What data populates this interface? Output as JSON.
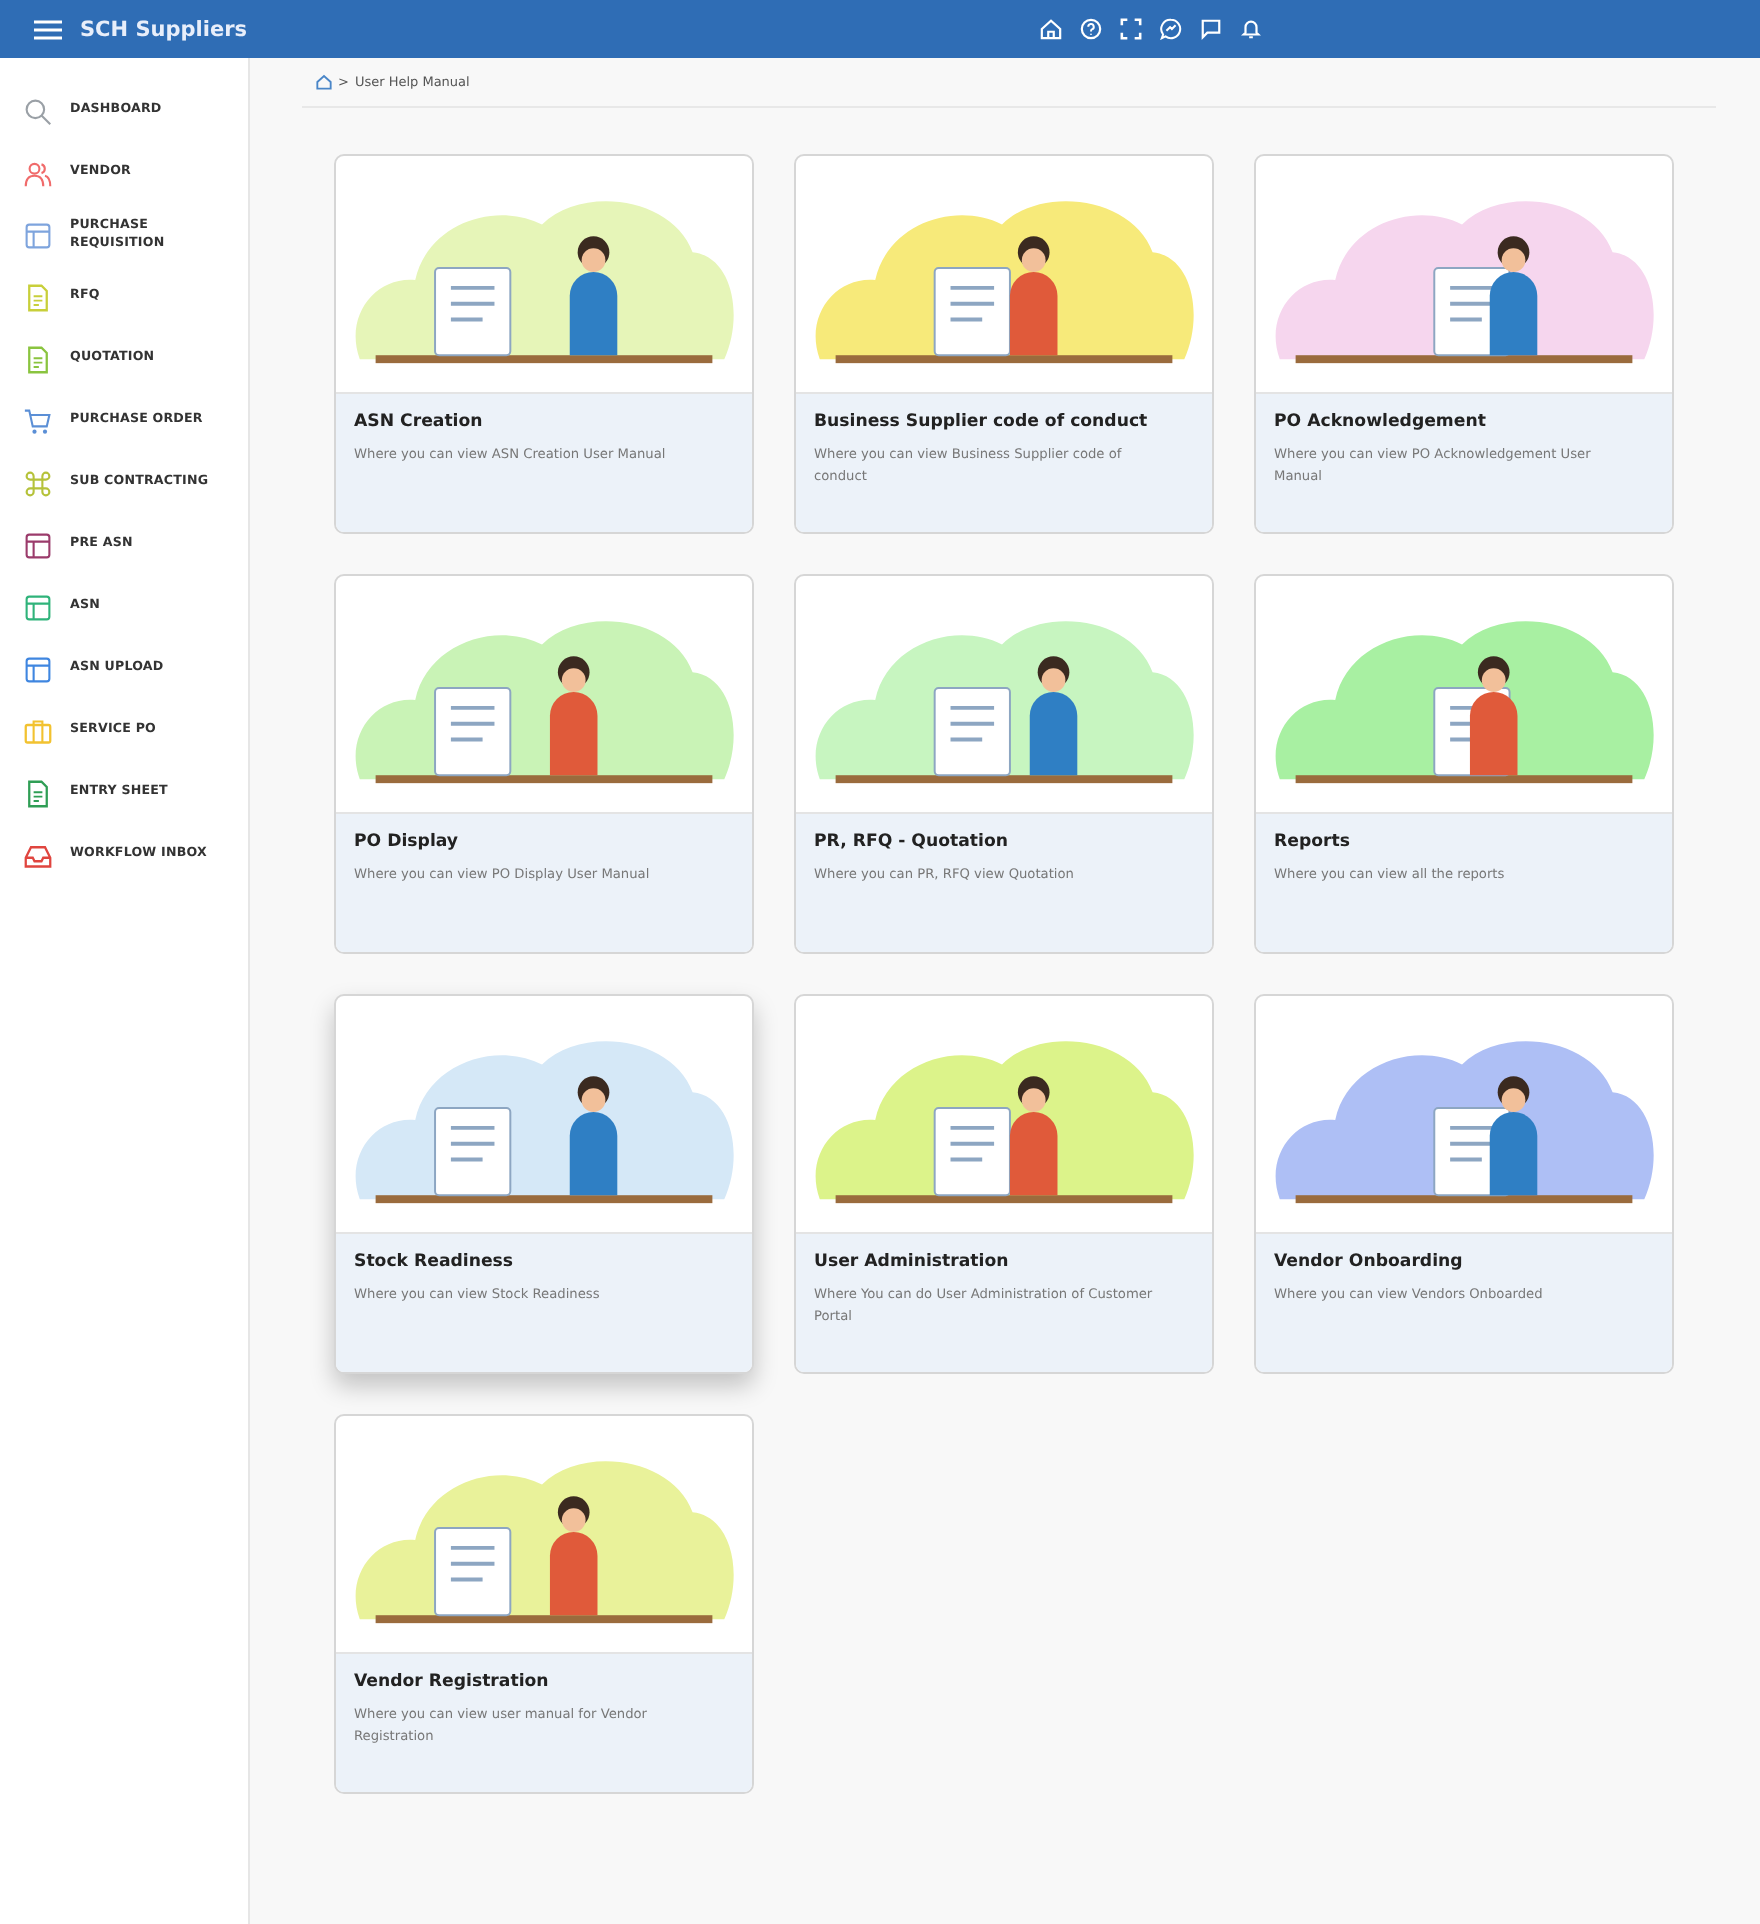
{
  "header": {
    "title": "SCH Suppliers"
  },
  "sidebar": {
    "items": [
      {
        "label": "DASHBOARD",
        "kind": "search",
        "color": "#9aa0a6"
      },
      {
        "label": "VENDOR",
        "kind": "people",
        "color": "#f06b6b"
      },
      {
        "label": "PURCHASE REQUISITION",
        "kind": "layout",
        "color": "#7ea4dd"
      },
      {
        "label": "RFQ",
        "kind": "doc",
        "color": "#c8cf3a"
      },
      {
        "label": "QUOTATION",
        "kind": "doc",
        "color": "#8ac43f"
      },
      {
        "label": "PURCHASE ORDER",
        "kind": "cart",
        "color": "#5b8fd6"
      },
      {
        "label": "SUB CONTRACTING",
        "kind": "command",
        "color": "#b5c23a"
      },
      {
        "label": "PRE ASN",
        "kind": "layout",
        "color": "#9b3b6b"
      },
      {
        "label": "ASN",
        "kind": "layout",
        "color": "#2fb37a"
      },
      {
        "label": "ASN UPLOAD",
        "kind": "layout",
        "color": "#3f86e0"
      },
      {
        "label": "SERVICE PO",
        "kind": "briefcase",
        "color": "#f2c230"
      },
      {
        "label": "ENTRY SHEET",
        "kind": "doc",
        "color": "#2f9e55"
      },
      {
        "label": "WORKFLOW INBOX",
        "kind": "inbox",
        "color": "#e0453f"
      }
    ]
  },
  "breadcrumb": {
    "separator": ">",
    "current": "User Help Manual"
  },
  "cards": [
    {
      "title": "ASN Creation",
      "description": "Where you can view ASN Creation User Manual",
      "color": "#e6f5b8",
      "raised": false
    },
    {
      "title": "Business Supplier code of conduct",
      "description": "Where you can view Business Supplier code of conduct",
      "color": "#f7ea7a",
      "raised": false
    },
    {
      "title": "PO Acknowledgement",
      "description": "Where you can view PO Acknowledgement User Manual",
      "color": "#f6d6ee",
      "raised": false
    },
    {
      "title": "PO Display",
      "description": "Where you can view PO Display User Manual",
      "color": "#c9f3b6",
      "raised": false
    },
    {
      "title": "PR, RFQ - Quotation",
      "description": "Where you can PR, RFQ view Quotation",
      "color": "#c7f5c0",
      "raised": false
    },
    {
      "title": "Reports",
      "description": "Where you can view all the reports",
      "color": "#a8f0a2",
      "raised": false
    },
    {
      "title": "Stock Readiness",
      "description": "Where you can view Stock Readiness",
      "color": "#d5e8f7",
      "raised": true
    },
    {
      "title": "User Administration",
      "description": "Where You can do User Administration of Customer Portal",
      "color": "#dcf38a",
      "raised": false
    },
    {
      "title": "Vendor Onboarding",
      "description": "Where you can view Vendors Onboarded",
      "color": "#aebff5",
      "raised": false
    },
    {
      "title": "Vendor Registration",
      "description": "Where you can view user manual for Vendor Registration",
      "color": "#e9f29a",
      "raised": false
    }
  ]
}
